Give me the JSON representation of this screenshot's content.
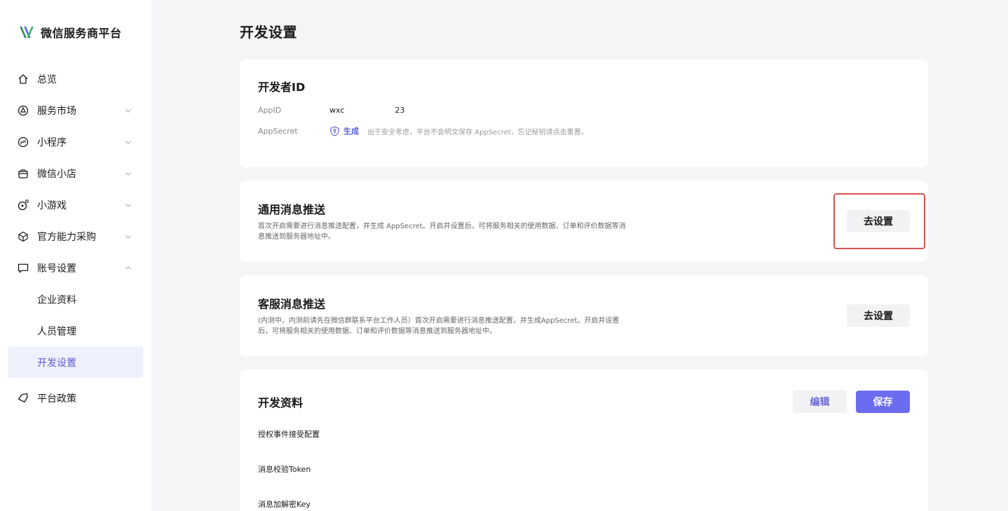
{
  "sidebar": {
    "brand": "微信服务商平台",
    "items": [
      {
        "label": "总览"
      },
      {
        "label": "服务市场"
      },
      {
        "label": "小程序"
      },
      {
        "label": "微信小店"
      },
      {
        "label": "小游戏"
      },
      {
        "label": "官方能力采购"
      },
      {
        "label": "账号设置"
      }
    ],
    "sub_items": [
      {
        "label": "企业资料"
      },
      {
        "label": "人员管理"
      },
      {
        "label": "开发设置"
      }
    ],
    "last_item": {
      "label": "平台政策"
    }
  },
  "page": {
    "title": "开发设置"
  },
  "developer_id": {
    "title": "开发者ID",
    "appid_label": "AppID",
    "appid_value_prefix": "wxc",
    "appid_value_suffix": "23",
    "secret_label": "AppSecret",
    "generate_label": "生成",
    "secret_note": "出于安全考虑，平台不会明文保存 AppSecret，忘记秘钥请点击重置。"
  },
  "general_push": {
    "title": "通用消息推送",
    "desc": "首次开启需要进行消息推送配置，并生成 AppSecret。开启并设置后，可将服务相关的使用数据、订单和评价数据等消息推送到服务器地址中。",
    "button": "去设置"
  },
  "service_push": {
    "title": "客服消息推送",
    "desc": "(内测中，内测前请先在微信群联系平台工作人员）首次开启需要进行消息推送配置，并生成AppSecret。开启并设置后，可将服务相关的使用数据、订单和评价数据等消息推送到服务器地址中。",
    "button": "去设置"
  },
  "dev_info": {
    "title": "开发资料",
    "edit_label": "编辑",
    "save_label": "保存",
    "fields": [
      "授权事件接受配置",
      "消息校验Token",
      "消息加解密Key"
    ]
  },
  "colors": {
    "accent": "#6c6cf0",
    "active_bg": "#eef0fb",
    "highlight": "#d9534f"
  }
}
